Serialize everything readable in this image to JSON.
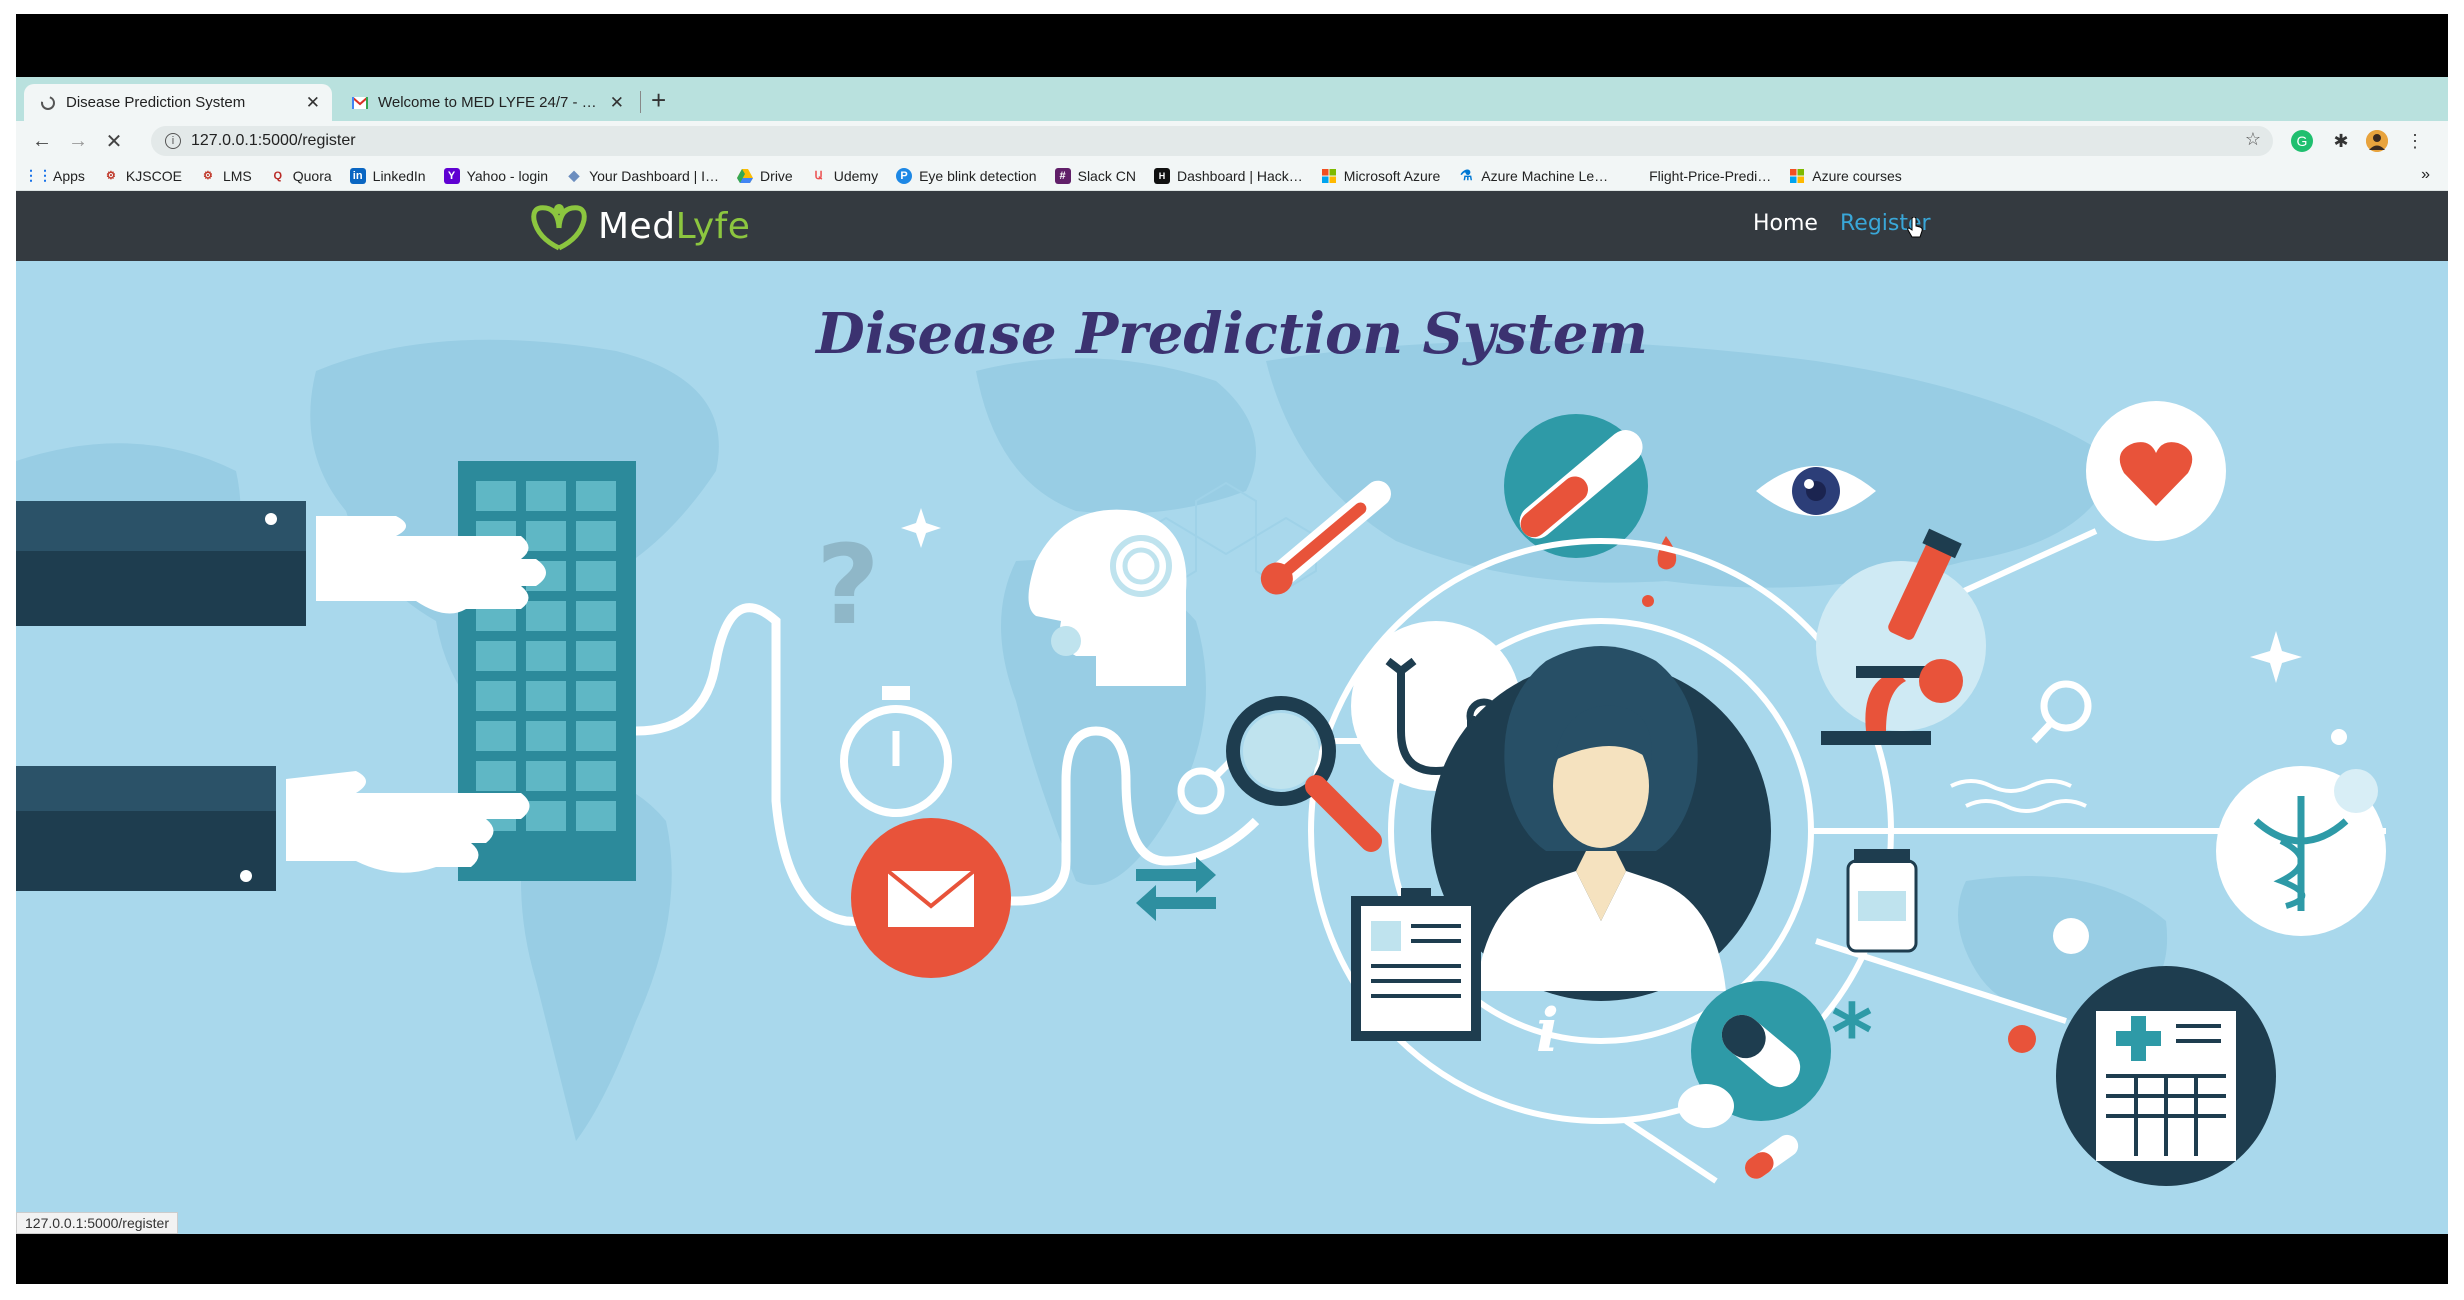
{
  "browser": {
    "tabs": [
      {
        "title": "Disease Prediction System",
        "active": true,
        "icon": "spinner-icon"
      },
      {
        "title": "Welcome to MED LYFE 24/7 - …",
        "active": false,
        "icon": "gmail-icon"
      }
    ],
    "url": "127.0.0.1:5000/register",
    "bookmarks": [
      {
        "label": "Apps",
        "icon": "apps-grid-icon",
        "color": "#1a73e8"
      },
      {
        "label": "KJSCOE",
        "icon": "kjscoe-icon",
        "color": "#c0392b"
      },
      {
        "label": "LMS",
        "icon": "lms-icon",
        "color": "#c0392b"
      },
      {
        "label": "Quora",
        "icon": "quora-icon",
        "color": "#b92b27"
      },
      {
        "label": "LinkedIn",
        "icon": "linkedin-icon",
        "color": "#0a66c2"
      },
      {
        "label": "Yahoo - login",
        "icon": "yahoo-icon",
        "color": "#6001d2"
      },
      {
        "label": "Your Dashboard | I…",
        "icon": "diamond-icon",
        "color": "#6c8ebf"
      },
      {
        "label": "Drive",
        "icon": "drive-icon",
        "color": "#34a853"
      },
      {
        "label": "Udemy",
        "icon": "udemy-icon",
        "color": "#ec5252"
      },
      {
        "label": "Eye blink detection",
        "icon": "eye-blink-icon",
        "color": "#1e88e5"
      },
      {
        "label": "Slack CN",
        "icon": "slack-icon",
        "color": "#611f69"
      },
      {
        "label": "Dashboard | Hack…",
        "icon": "hackerrank-icon",
        "color": "#111111"
      },
      {
        "label": "Microsoft Azure",
        "icon": "microsoft-icon",
        "color": "#f25022"
      },
      {
        "label": "Azure Machine Le…",
        "icon": "flask-icon",
        "color": "#0078d4"
      },
      {
        "label": "Flight-Price-Predi…",
        "icon": "blank-icon",
        "color": "#ffffff"
      },
      {
        "label": "Azure courses",
        "icon": "microsoft-icon",
        "color": "#f25022"
      }
    ],
    "status_url": "127.0.0.1:5000/register"
  },
  "site": {
    "brand_part1": "Med",
    "brand_part2": "Lyfe",
    "nav": {
      "home": "Home",
      "register": "Register"
    },
    "title": "Disease Prediction System"
  },
  "colors": {
    "navbar": "#343a40",
    "hero_bg": "#a9d8ec",
    "title": "#3b3270",
    "register_link": "#39a7d8",
    "brand_green": "#8cc63f"
  }
}
